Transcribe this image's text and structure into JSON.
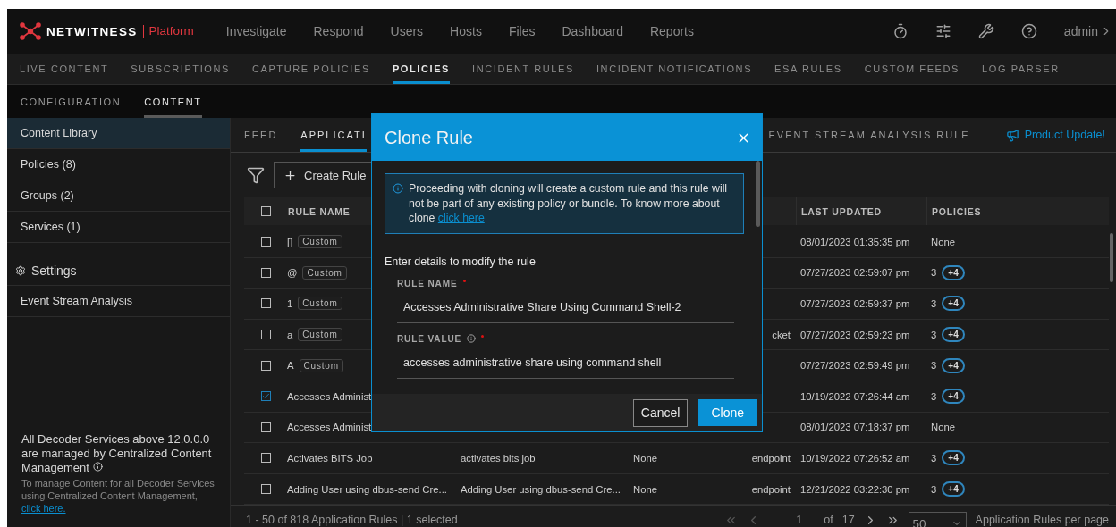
{
  "top_nav": {
    "brand": "NETWITNESS",
    "product": "Platform",
    "items": [
      "Investigate",
      "Respond",
      "Users",
      "Hosts",
      "Files",
      "Dashboard",
      "Reports"
    ],
    "user": "admin"
  },
  "sub_nav": [
    {
      "label": "LIVE CONTENT",
      "selected": false
    },
    {
      "label": "SUBSCRIPTIONS",
      "selected": false
    },
    {
      "label": "CAPTURE POLICIES",
      "selected": false
    },
    {
      "label": "POLICIES",
      "selected": true
    },
    {
      "label": "INCIDENT RULES",
      "selected": false
    },
    {
      "label": "INCIDENT NOTIFICATIONS",
      "selected": false
    },
    {
      "label": "ESA RULES",
      "selected": false
    },
    {
      "label": "CUSTOM FEEDS",
      "selected": false
    },
    {
      "label": "LOG PARSER",
      "selected": false
    }
  ],
  "section_tabs": [
    {
      "label": "CONFIGURATION",
      "selected": false
    },
    {
      "label": "CONTENT",
      "selected": true
    }
  ],
  "sidebar": {
    "items": [
      {
        "kind": "item",
        "label": "Content Library",
        "selected": true
      },
      {
        "kind": "item",
        "label": "Policies (8)",
        "selected": false
      },
      {
        "kind": "item",
        "label": "Groups (2)",
        "selected": false
      },
      {
        "kind": "item",
        "label": "Services (1)",
        "selected": false
      },
      {
        "kind": "heading",
        "label": "Settings",
        "selected": false
      },
      {
        "kind": "item",
        "label": "Event Stream Analysis",
        "selected": false
      }
    ],
    "notice": {
      "title": "All Decoder Services above 12.0.0.0 are managed by Centralized Content Management",
      "text": "To manage Content for all Decoder Services using Centralized Content Management, ",
      "link": "click here."
    }
  },
  "content_tabs": [
    {
      "label": "FEED",
      "selected": false
    },
    {
      "label": "APPLICATI",
      "selected": true
    }
  ],
  "content_tab_right": {
    "label": "EVENT STREAM ANALYSIS RULE",
    "selected": false
  },
  "product_update": "Product Update!",
  "toolbar": {
    "create_button": "Create Rule"
  },
  "table": {
    "all_checked": false,
    "columns": {
      "rule_name": "RULE NAME",
      "last_updated": "LAST UPDATED",
      "policies": "POLICIES"
    },
    "rows": [
      {
        "checked": false,
        "rule_name": "[]",
        "tag": "Custom",
        "last_updated": "08/01/2023 01:35:35 pm",
        "policies": "None"
      },
      {
        "checked": false,
        "rule_name": "@",
        "tag": "Custom",
        "last_updated": "07/27/2023 02:59:07 pm",
        "policies": "3",
        "policies_more": "+4"
      },
      {
        "checked": false,
        "rule_name": "1",
        "tag": "Custom",
        "last_updated": "07/27/2023 02:59:37 pm",
        "policies": "3",
        "policies_more": "+4"
      },
      {
        "checked": false,
        "rule_name": "a",
        "tag": "Custom",
        "column_4": "cket",
        "last_updated": "07/27/2023 02:59:23 pm",
        "policies": "3",
        "policies_more": "+4"
      },
      {
        "checked": false,
        "rule_name": "A",
        "tag": "Custom",
        "last_updated": "07/27/2023 02:59:49 pm",
        "policies": "3",
        "policies_more": "+4"
      },
      {
        "checked": true,
        "rule_name": "Accesses Administ",
        "last_updated": "10/19/2022 07:26:44 am",
        "policies": "3",
        "policies_more": "+4"
      },
      {
        "checked": false,
        "rule_name": "Accesses Administ",
        "last_updated": "08/01/2023 07:18:37 pm",
        "policies": "None"
      },
      {
        "checked": false,
        "rule_name": "Activates BITS Job",
        "rule_value": "activates bits job",
        "column_3": "None",
        "column_4": "endpoint",
        "last_updated": "10/19/2022 07:26:52 am",
        "policies": "3",
        "policies_more": "+4"
      },
      {
        "checked": false,
        "rule_name": "Adding User using dbus-send Cre...",
        "rule_value": "Adding User using dbus-send Cre...",
        "column_3": "None",
        "column_4": "endpoint",
        "last_updated": "12/21/2022 03:22:30 pm",
        "policies": "3",
        "policies_more": "+4"
      }
    ]
  },
  "footer": {
    "summary": "1 - 50 of 818 Application Rules | 1 selected",
    "page": "1",
    "of": "of",
    "pages": "17",
    "per_page": "50",
    "per_page_label": "Application Rules per page"
  },
  "modal": {
    "title": "Clone Rule",
    "info_text": "Proceeding with cloning will create a custom rule and this rule will not be part of any existing policy or bundle. To know more about clone ",
    "info_link": "click here",
    "intro": "Enter details to modify the rule",
    "fields": [
      {
        "label": "RULE NAME",
        "required": true,
        "value": "Accesses Administrative Share Using Command Shell-2"
      },
      {
        "label": "RULE VALUE",
        "info": true,
        "required": true,
        "value": "accesses administrative share using command shell"
      }
    ],
    "cancel": "Cancel",
    "confirm": "Clone"
  }
}
